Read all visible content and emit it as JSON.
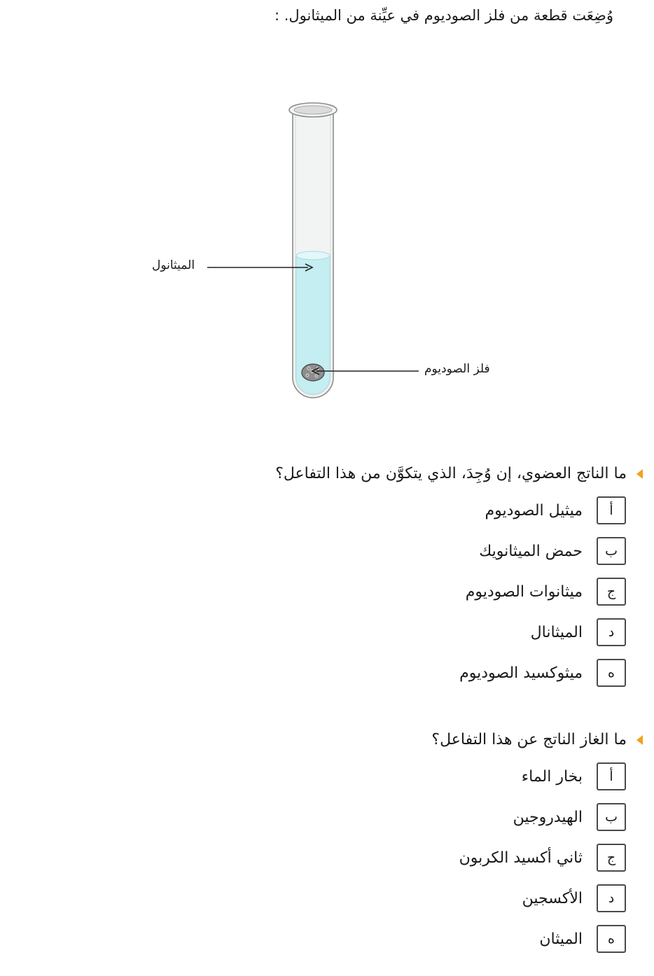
{
  "intro": "وُضِعَت قطعة من فلز الصوديوم في عيِّنة من الميثانول.  :",
  "figure": {
    "methanol_label": "الميثانول",
    "sodium_label": "فلز الصوديوم",
    "liquid_color": "#c4eef2",
    "tube_color": "#f2f3f3",
    "sodium_color": "#8e8e8e"
  },
  "marker_color": "#f0a21e",
  "questions": [
    {
      "prompt": "ما الناتج العضوي، إن وُجِدَ، الذي يتكوَّن من هذا التفاعل؟",
      "options": [
        {
          "letter": "أ",
          "text": "ميثيل الصوديوم"
        },
        {
          "letter": "ب",
          "text": "حمض الميثانويك"
        },
        {
          "letter": "ج",
          "text": "ميثانوات الصوديوم"
        },
        {
          "letter": "د",
          "text": "الميثانال"
        },
        {
          "letter": "ه",
          "text": "ميثوكسيد الصوديوم"
        }
      ]
    },
    {
      "prompt": "ما الغاز الناتج عن هذا التفاعل؟",
      "options": [
        {
          "letter": "أ",
          "text": "بخار الماء"
        },
        {
          "letter": "ب",
          "text": "الهيدروجين"
        },
        {
          "letter": "ج",
          "text": "ثاني أكسيد الكربون"
        },
        {
          "letter": "د",
          "text": "الأكسجين"
        },
        {
          "letter": "ه",
          "text": "الميثان"
        }
      ]
    }
  ]
}
